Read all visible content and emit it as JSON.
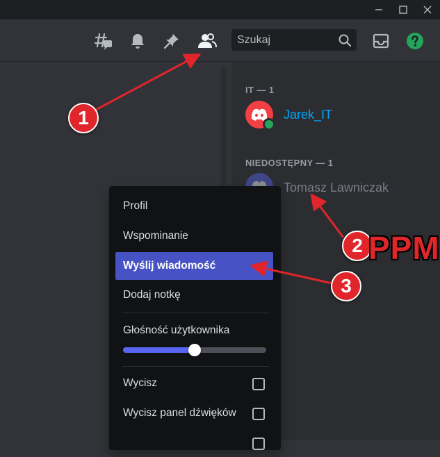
{
  "window": {
    "controls": [
      "minimize-icon",
      "maximize-icon",
      "close-icon"
    ]
  },
  "header": {
    "icons": [
      "threads-icon",
      "bell-icon",
      "pin-icon",
      "members-icon",
      "inbox-icon",
      "help-icon"
    ],
    "search": {
      "placeholder": "Szukaj"
    }
  },
  "members": {
    "groups": [
      {
        "title": "IT — 1",
        "members": [
          {
            "name": "Jarek_IT",
            "color": "#00a8fc",
            "status": "online"
          }
        ]
      },
      {
        "title": "NIEDOSTĘPNY — 1",
        "members": [
          {
            "name": "Tomasz Lawniczak",
            "color": "#949ba4",
            "status": "offline"
          }
        ]
      }
    ]
  },
  "context_menu": {
    "profile": "Profil",
    "mention": "Wspominanie",
    "send_message": "Wyślij wiadomość",
    "add_note": "Dodaj notkę",
    "user_volume": "Głośność użytkownika",
    "volume_level": 0.5,
    "mute": "Wycisz",
    "mute_soundboard": "Wycisz panel dźwięków"
  },
  "annotations": {
    "step1": "1",
    "step2": "2",
    "step3": "3",
    "ppm": "PPM",
    "color": "#e0262b"
  },
  "colors": {
    "accent": "#5865f2",
    "menu_highlight": "#4752c4",
    "online": "#23a55a",
    "help": "#23a55a"
  }
}
